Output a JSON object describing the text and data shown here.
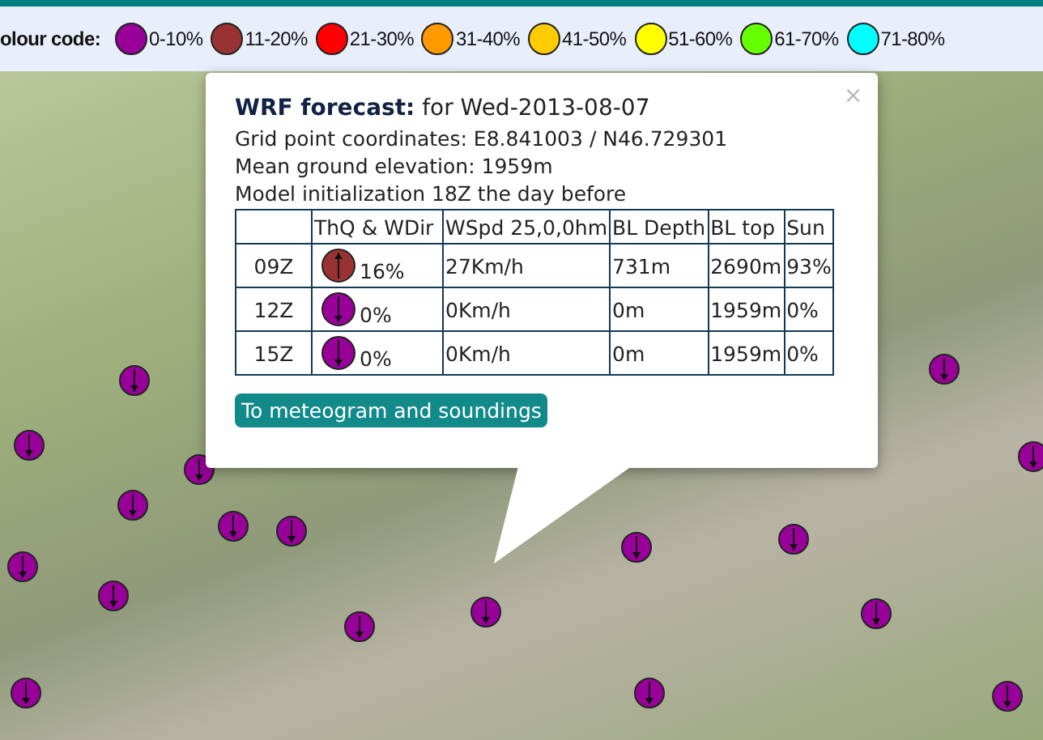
{
  "legend": {
    "label": "olour code:",
    "items": [
      {
        "label": "0-10%",
        "color": "#990099"
      },
      {
        "label": "11-20%",
        "color": "#993333"
      },
      {
        "label": "21-30%",
        "color": "#ff0000"
      },
      {
        "label": "31-40%",
        "color": "#ff9900"
      },
      {
        "label": "41-50%",
        "color": "#ffcc00"
      },
      {
        "label": "51-60%",
        "color": "#ffff00"
      },
      {
        "label": "61-70%",
        "color": "#66ff00"
      },
      {
        "label": "71-80%",
        "color": "#00ffff"
      }
    ]
  },
  "popup": {
    "title": "WRF forecast:",
    "date": "for Wed-2013-08-07",
    "lines": [
      "Grid point coordinates: E8.841003 / N46.729301",
      "Mean ground elevation: 1959m",
      "Model initialization 18Z the day before"
    ],
    "close": "×",
    "columns": [
      "ThQ & WDir",
      "WSpd 25,0,0hm",
      "BL Depth",
      "BL top",
      "Sun"
    ],
    "rows": [
      {
        "time": "09Z",
        "color": "#993333",
        "kind": "up",
        "thq": "16%",
        "wspd": "27Km/h",
        "bl_depth": "731m",
        "bl_top": "2690m",
        "sun": "93%"
      },
      {
        "time": "12Z",
        "color": "#990099",
        "kind": "down",
        "thq": "0%",
        "wspd": "0Km/h",
        "bl_depth": "0m",
        "bl_top": "1959m",
        "sun": "0%"
      },
      {
        "time": "15Z",
        "color": "#990099",
        "kind": "down",
        "thq": "0%",
        "wspd": "0Km/h",
        "bl_depth": "0m",
        "bl_top": "1959m",
        "sun": "0%"
      }
    ],
    "button": "To meteogram and soundings"
  }
}
